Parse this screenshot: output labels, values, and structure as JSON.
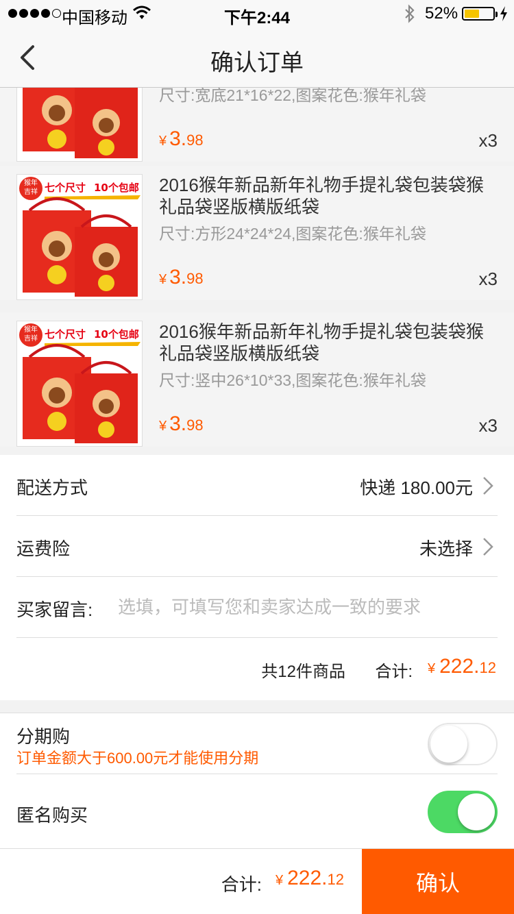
{
  "status_bar": {
    "carrier": "中国移动",
    "time": "下午2:44",
    "battery_percent": "52%",
    "battery_level": 0.52,
    "icons": [
      "signal-icon",
      "wifi-icon",
      "bluetooth-icon",
      "battery-icon",
      "charging-icon"
    ]
  },
  "nav": {
    "title": "确认订单",
    "back_icon": "chevron-left-icon"
  },
  "products": [
    {
      "name": "",
      "spec": "尺寸:宽底21*16*22,图案花色:猴年礼袋",
      "price_symbol": "¥",
      "price_int": "3.",
      "price_dec": "98",
      "qty": "x3"
    },
    {
      "name": "2016猴年新品新年礼物手提礼袋包装袋猴礼品袋竖版横版纸袋",
      "spec": "尺寸:方形24*24*24,图案花色:猴年礼袋",
      "price_symbol": "¥",
      "price_int": "3.",
      "price_dec": "98",
      "qty": "x3"
    },
    {
      "name": "2016猴年新品新年礼物手提礼袋包装袋猴礼品袋竖版横版纸袋",
      "spec": "尺寸:竖中26*10*33,图案花色:猴年礼袋",
      "price_symbol": "¥",
      "price_int": "3.",
      "price_dec": "98",
      "qty": "x3"
    }
  ],
  "thumb": {
    "badge_line1": "猴年",
    "badge_line2": "吉祥",
    "banner_a": "七个尺寸",
    "banner_b": "10个包邮"
  },
  "delivery": {
    "label": "配送方式",
    "value": "快递 180.00元"
  },
  "insurance": {
    "label": "运费险",
    "value": "未选择"
  },
  "message": {
    "label": "买家留言:",
    "placeholder": "选填，可填写您和卖家达成一致的要求"
  },
  "summary": {
    "count": "共12件商品",
    "total_label": "合计:",
    "price_symbol": "¥",
    "price_int": "222.",
    "price_dec": "12"
  },
  "installment": {
    "label": "分期购",
    "note": "订单金额大于600.00元才能使用分期",
    "enabled": false
  },
  "anonymous": {
    "label": "匿名购买",
    "enabled": true
  },
  "bottom": {
    "total_label": "合计:",
    "price_symbol": "¥",
    "price_int": "222.",
    "price_dec": "12",
    "confirm_label": "确认"
  },
  "colors": {
    "accent": "#ff5a00",
    "switch_on": "#4cd964",
    "battery": "#f5c400"
  }
}
